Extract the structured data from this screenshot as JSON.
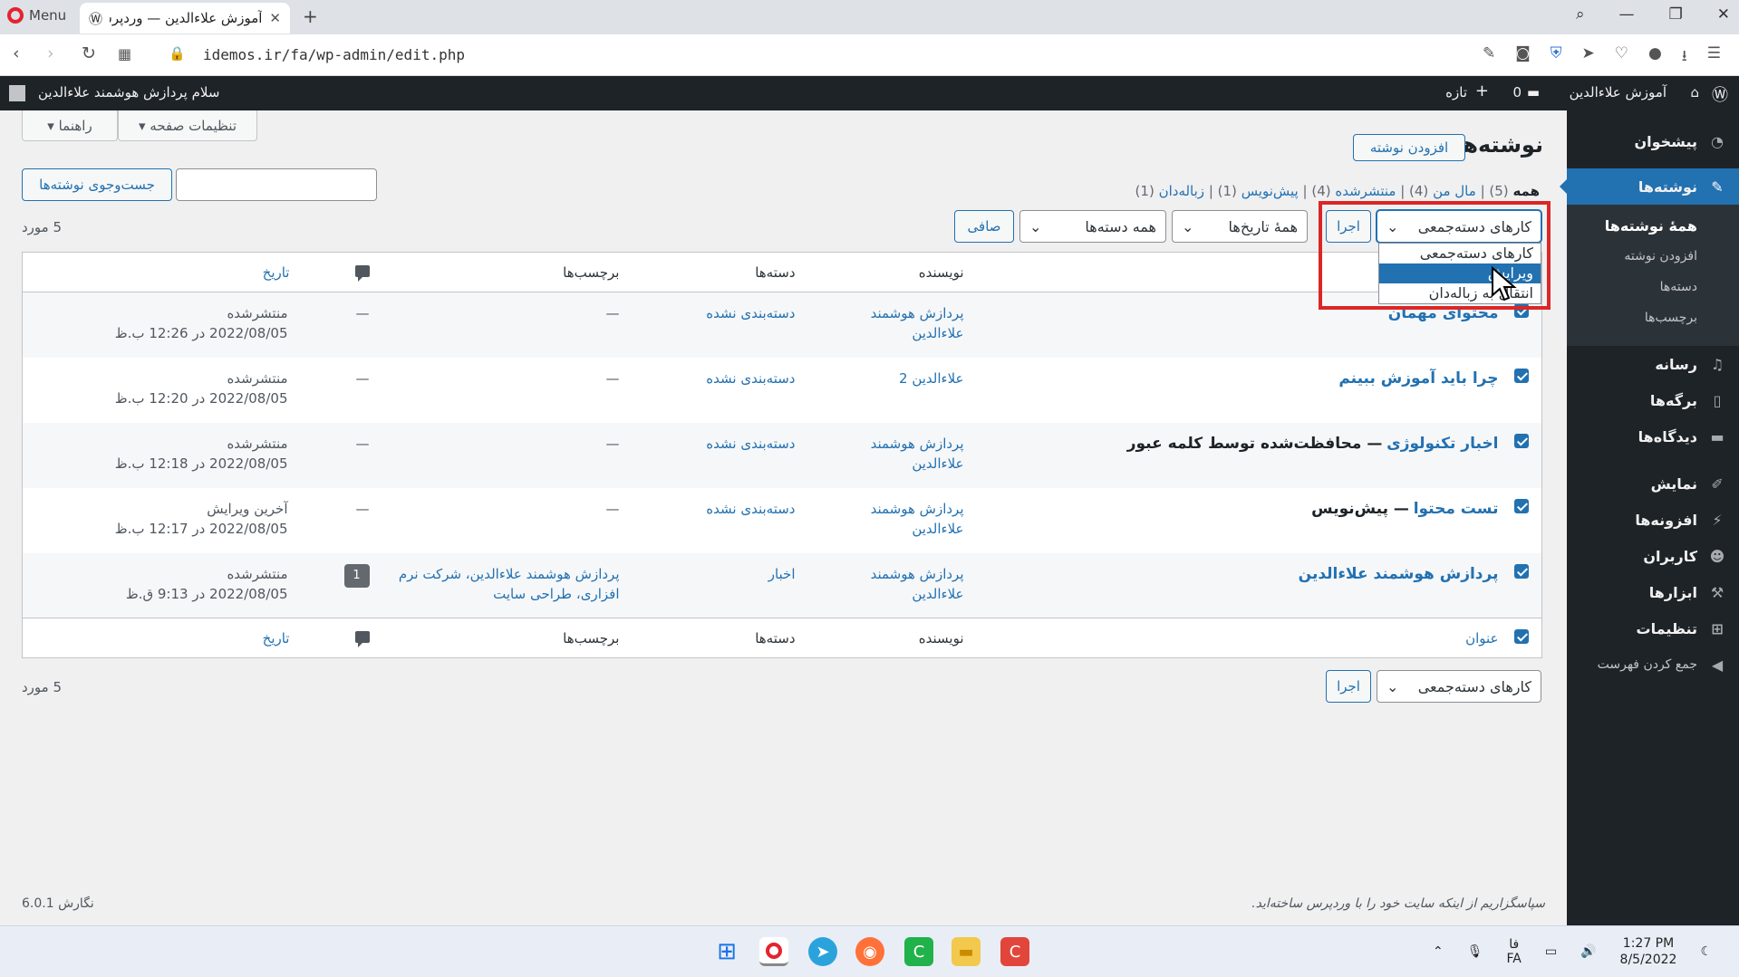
{
  "browser": {
    "menu_label": "Menu",
    "tab_title": "آموزش علاءالدین — وردپرس",
    "url": "idemos.ir/fa/wp-admin/edit.php"
  },
  "adminbar": {
    "greeting": "سلام پردازش هوشمند علاءالدین",
    "site_name": "آموزش علاءالدین",
    "comments_count": "0",
    "new_label": "تازه"
  },
  "sidebar": {
    "dashboard": "پیشخوان",
    "posts": "نوشته‌ها",
    "submenu": [
      "همهٔ نوشته‌ها",
      "افزودن نوشته",
      "دسته‌ها",
      "برچسب‌ها"
    ],
    "media": "رسانه",
    "pages": "برگه‌ها",
    "comments": "دیدگاه‌ها",
    "appearance": "نمایش",
    "plugins": "افزونه‌ها",
    "users": "کاربران",
    "tools": "ابزارها",
    "settings": "تنظیمات",
    "collapse": "جمع کردن فهرست"
  },
  "screen": {
    "options": "تنظیمات صفحه",
    "help": "راهنما"
  },
  "header": {
    "title": "نوشته‌ها",
    "add_new": "افزودن نوشته"
  },
  "filters": {
    "all": "همه",
    "all_count": "(5)",
    "mine": "مال من",
    "mine_count": "(4)",
    "published": "منتشرشده",
    "published_count": "(4)",
    "drafts": "پیش‌نویس",
    "drafts_count": "(1)",
    "trash": "زباله‌دان",
    "trash_count": "(1)"
  },
  "search": {
    "button": "جست‌وجوی نوشته‌ها"
  },
  "toolbar": {
    "bulk_actions": "کارهای دسته‌جمعی",
    "apply": "اجرا",
    "all_dates": "همهٔ تاریخ‌ها",
    "all_categories": "همه دسته‌ها",
    "filter": "صافی",
    "items_count": "5 مورد"
  },
  "bulk_dropdown": {
    "options": [
      "کارهای دسته‌جمعی",
      "ویرایش",
      "انتقال به زباله‌دان"
    ]
  },
  "table": {
    "columns": {
      "title": "عنوان",
      "author": "نویسنده",
      "categories": "دسته‌ها",
      "tags": "برچسب‌ها",
      "date": "تاریخ"
    },
    "rows": [
      {
        "title": "محتوای مهمان",
        "state": "",
        "author": "پردازش هوشمند علاءالدین",
        "category": "دسته‌بندی نشده",
        "tags": "—",
        "comments": "—",
        "status": "منتشرشده",
        "date": "2022/08/05 در 12:26 ب.ظ"
      },
      {
        "title": "چرا باید آموزش ببینم",
        "state": "",
        "author": "علاءالدین 2",
        "category": "دسته‌بندی نشده",
        "tags": "—",
        "comments": "—",
        "status": "منتشرشده",
        "date": "2022/08/05 در 12:20 ب.ظ"
      },
      {
        "title": "اخبار تکنولوژی",
        "state": "— محافظت‌شده توسط کلمه عبور",
        "author": "پردازش هوشمند علاءالدین",
        "category": "دسته‌بندی نشده",
        "tags": "—",
        "comments": "—",
        "status": "منتشرشده",
        "date": "2022/08/05 در 12:18 ب.ظ"
      },
      {
        "title": "تست محتوا",
        "state": "— پیش‌نویس",
        "author": "پردازش هوشمند علاءالدین",
        "category": "دسته‌بندی نشده",
        "tags": "—",
        "comments": "—",
        "status": "آخرین ویرایش",
        "date": "2022/08/05 در 12:17 ب.ظ"
      },
      {
        "title": "پردازش هوشمند علاءالدین",
        "state": "",
        "author": "پردازش هوشمند علاءالدین",
        "category": "اخبار",
        "tags": "پردازش هوشمند علاءالدین، شرکت نرم افزاری، طراحی سایت",
        "comments": "1",
        "status": "منتشرشده",
        "date": "2022/08/05 در 9:13 ق.ظ"
      }
    ]
  },
  "footer": {
    "thanks": "سپاسگزاریم از اینکه سایت خود را با وردپرس ساخته‌اید.",
    "version": "نگارش 6.0.1"
  },
  "taskbar": {
    "time": "1:27 PM",
    "date": "8/5/2022",
    "lang_top": "فا",
    "lang_bottom": "FA"
  },
  "colors": {
    "accent": "#2271b1",
    "admin_dark": "#1d2327",
    "highlight": "#dc2626"
  }
}
